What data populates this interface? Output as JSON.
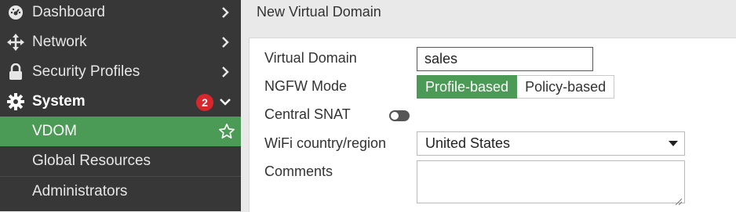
{
  "sidebar": {
    "items": [
      {
        "label": "Dashboard",
        "icon": "dashboard-icon"
      },
      {
        "label": "Network",
        "icon": "network-icon"
      },
      {
        "label": "Security Profiles",
        "icon": "lock-icon"
      },
      {
        "label": "System",
        "icon": "gear-icon",
        "badge": "2",
        "expanded": true
      }
    ],
    "sub_items": [
      {
        "label": "VDOM",
        "active": true
      },
      {
        "label": "Global Resources"
      },
      {
        "label": "Administrators"
      }
    ]
  },
  "main": {
    "title": "New Virtual Domain",
    "form": {
      "vdom_label": "Virtual Domain",
      "vdom_value": "sales",
      "ngfw_label": "NGFW Mode",
      "ngfw_options": [
        "Profile-based",
        "Policy-based"
      ],
      "ngfw_selected": "Profile-based",
      "snat_label": "Central SNAT",
      "snat_enabled": false,
      "wifi_label": "WiFi country/region",
      "wifi_value": "United States",
      "comments_label": "Comments",
      "comments_value": ""
    }
  },
  "colors": {
    "sidebar_bg": "#373737",
    "accent_green": "#4b9a55",
    "badge_red": "#d7262c"
  }
}
